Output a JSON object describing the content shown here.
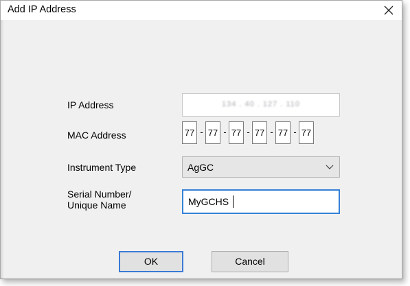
{
  "dialog": {
    "title": "Add IP Address",
    "close_icon": "close-icon"
  },
  "form": {
    "ip_label": "IP Address",
    "ip_value": "134 . 40 . 127 . 110",
    "mac_label": "MAC Address",
    "mac_octets": [
      "77",
      "77",
      "77",
      "77",
      "77",
      "77"
    ],
    "mac_separator": "-",
    "instrument_label": "Instrument Type",
    "instrument_value": "AgGC",
    "serial_label_line1": "Serial Number/",
    "serial_label_line2": "Unique Name",
    "serial_value": "MyGCHS"
  },
  "buttons": {
    "ok": "OK",
    "cancel": "Cancel"
  },
  "colors": {
    "focus_border": "#3580d6",
    "dialog_bg": "#f0f0f0"
  }
}
